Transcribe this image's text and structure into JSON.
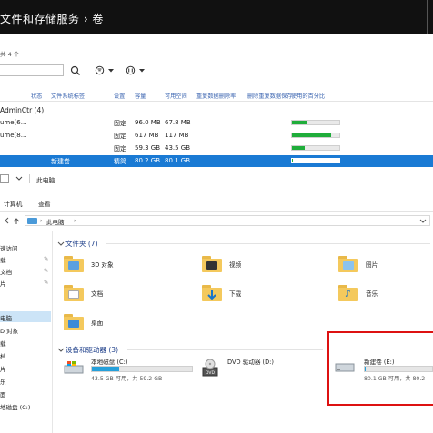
{
  "title_bar": {
    "title": "文件和存储服务 › 卷"
  },
  "volumes": {
    "count_text": "共 4 个",
    "columns": [
      "状态",
      "文件系统标签",
      "设置",
      "容量",
      "可用空间",
      "重复数据删除率",
      "删除重复数据保存",
      "使用的百分比"
    ],
    "group_label": "AdminCtr (4)",
    "rows": [
      {
        "name": "ume(6...",
        "setting": "固定",
        "capacity": "96.0 MB",
        "free": "67.8 MB",
        "used_pct": 0.3
      },
      {
        "name": "ume(8...",
        "setting": "固定",
        "capacity": "617 MB",
        "free": "117 MB",
        "used_pct": 0.82
      },
      {
        "name": "",
        "setting": "固定",
        "capacity": "59.3 GB",
        "free": "43.5 GB",
        "used_pct": 0.27
      },
      {
        "name": "",
        "label": "新建卷",
        "setting": "精简",
        "capacity": "80.2 GB",
        "free": "80.1 GB",
        "used_pct": 0.02
      }
    ]
  },
  "explorer": {
    "breadcrumb_title": "此电脑",
    "ribbon_tabs": [
      "计算机",
      "查看"
    ],
    "address_sep": "›",
    "address": "此电脑",
    "address_tail": "›",
    "nav_items": [
      "速访问",
      "载",
      "文档",
      "片",
      "电脑",
      "D 对象",
      "载",
      "档",
      "片",
      "乐",
      "面",
      "地磁盘 (C:)"
    ],
    "folders_header": "文件夹 (7)",
    "folders": [
      {
        "name": "3D 对象"
      },
      {
        "name": "视频"
      },
      {
        "name": "图片"
      },
      {
        "name": "文档"
      },
      {
        "name": "下载"
      },
      {
        "name": "音乐"
      },
      {
        "name": "桌面"
      }
    ],
    "devices_header": "设备和驱动器 (3)",
    "drives": [
      {
        "name": "本地磁盘 (C:)",
        "space": "43.5 GB 可用，共 59.2 GB",
        "used_pct": 0.27
      },
      {
        "name": "DVD 驱动器 (D:)",
        "space": "",
        "used_pct": 0
      },
      {
        "name": "新建卷 (E:)",
        "space": "80.1 GB 可用，共 80.2",
        "used_pct": 0.01
      }
    ]
  }
}
